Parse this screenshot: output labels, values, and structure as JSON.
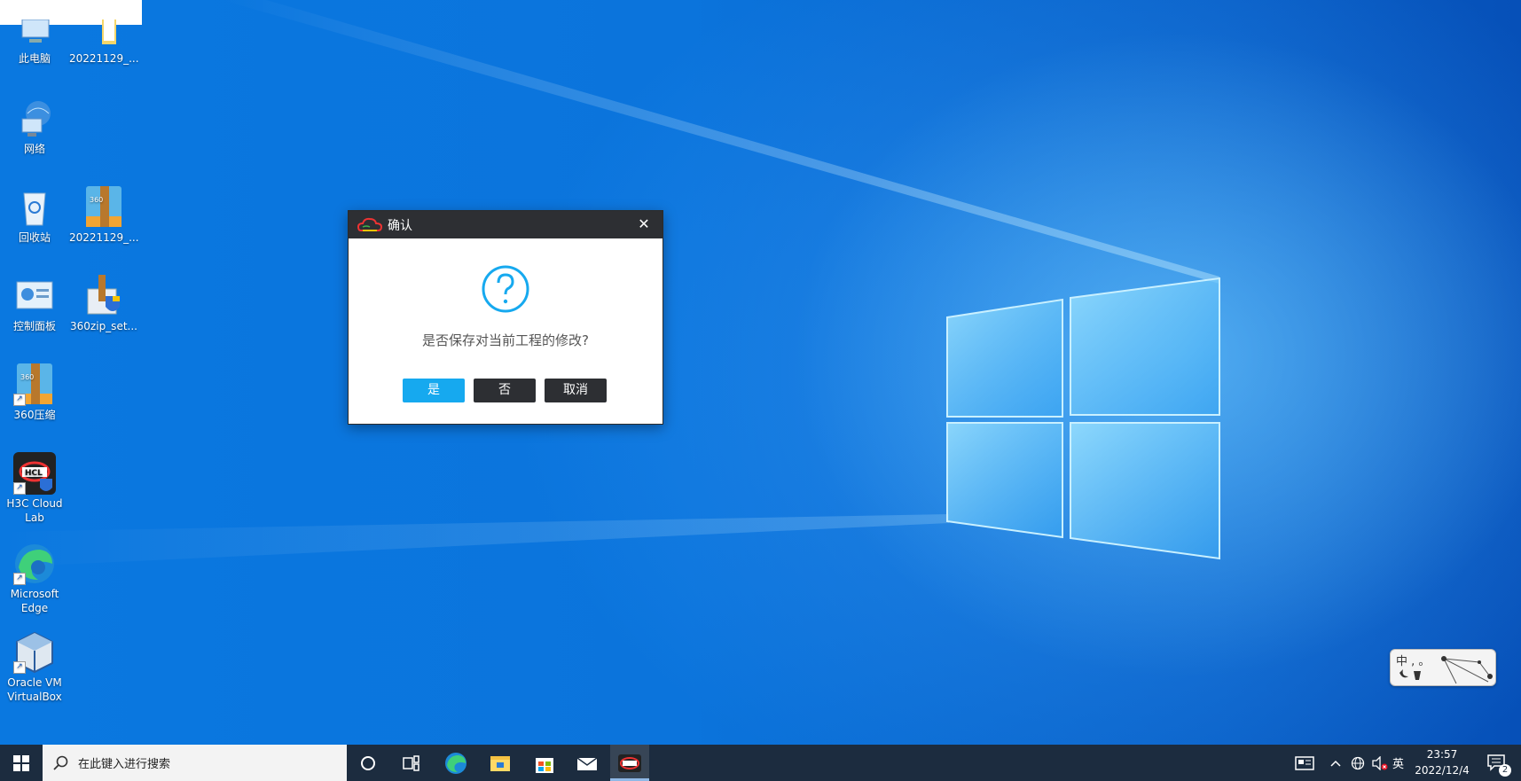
{
  "desktop": {
    "icons": [
      {
        "id": "this-pc",
        "label": "此电脑"
      },
      {
        "id": "folder-20221129",
        "label": "20221129_..."
      },
      {
        "id": "network",
        "label": "网络"
      },
      {
        "id": "recycle-bin",
        "label": "回收站"
      },
      {
        "id": "zip-20221129",
        "label": "20221129_..."
      },
      {
        "id": "control-panel",
        "label": "控制面板"
      },
      {
        "id": "360zip-setup",
        "label": "360zip_set..."
      },
      {
        "id": "360zip",
        "label": "360压缩"
      },
      {
        "id": "h3c-cloud-lab",
        "label": "H3C Cloud Lab"
      },
      {
        "id": "edge",
        "label": "Microsoft Edge"
      },
      {
        "id": "virtualbox",
        "label": "Oracle VM VirtualBox"
      }
    ]
  },
  "dialog": {
    "title": "确认",
    "message": "是否保存对当前工程的修改?",
    "close_icon": "✕",
    "yes_label": "是",
    "no_label": "否",
    "cancel_label": "取消",
    "accent_color": "#16a9ef"
  },
  "ime": {
    "text": "中 , 。"
  },
  "taskbar": {
    "search_placeholder": "在此键入进行搜索",
    "tray": {
      "lang": "英",
      "time": "23:57",
      "date": "2022/12/4",
      "notifications": "2"
    }
  }
}
